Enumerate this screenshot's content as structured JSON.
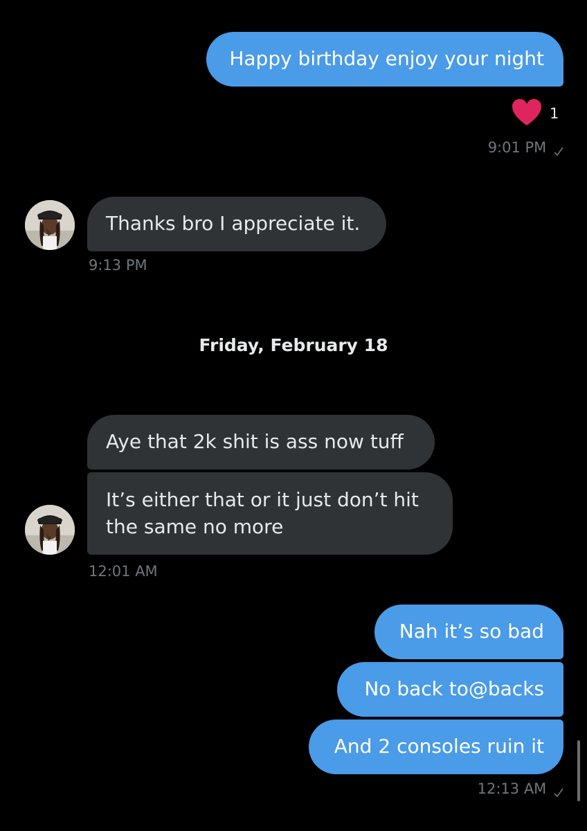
{
  "messages": {
    "m1": {
      "text": "Happy birthday enjoy your night"
    },
    "m1_reaction": {
      "icon": "heart-icon",
      "count": "1",
      "color": "#e0245e"
    },
    "m1_time": "9:01 PM",
    "m2": {
      "text": "Thanks bro I appreciate it."
    },
    "m2_time": "9:13 PM",
    "date_separator": "Friday, February 18",
    "m3": {
      "text": "Aye that 2k shit is ass now tuff"
    },
    "m4": {
      "text": "It’s either that or it just don’t hit the same no more"
    },
    "m4_time": "12:01 AM",
    "m5": {
      "text": "Nah it’s so bad"
    },
    "m6": {
      "text": "No back to@backs"
    },
    "m7": {
      "text": "And 2 consoles ruin it"
    },
    "m7_time": "12:13 AM"
  },
  "colors": {
    "background": "#000000",
    "outgoing_bubble": "#4a9be8",
    "incoming_bubble": "#2f3336",
    "timestamp": "#71767b",
    "heart": "#e0245e"
  },
  "icons": {
    "sent_status": "checkmark-icon",
    "avatar": "avatar"
  }
}
